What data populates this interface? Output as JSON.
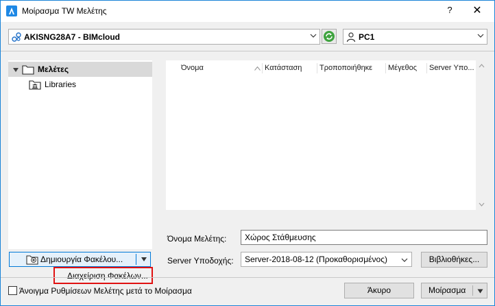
{
  "window": {
    "title": "Μοίρασμα TW Μελέτης"
  },
  "titlebar": {
    "help_label": "?",
    "close_label": "✕"
  },
  "server_combo": {
    "value": "AKISNG28A7 - BIMcloud"
  },
  "user_combo": {
    "value": "PC1"
  },
  "tree": {
    "items": [
      {
        "label": "Μελέτες",
        "selected": true
      },
      {
        "label": "Libraries",
        "selected": false
      }
    ]
  },
  "list": {
    "columns": [
      "Όνομα",
      "Κατάσταση",
      "Τροποποιήθηκε",
      "Μέγεθος",
      "Server Υπο..."
    ],
    "rows": []
  },
  "form": {
    "project_name_label": "Όνομα Μελέτης:",
    "project_name_value": "Χώρος Στάθμευσης",
    "host_server_label": "Server Υποδοχής:",
    "host_server_value": "Server-2018-08-12 (Προκαθορισμένος)",
    "libraries_button": "Βιβλιοθήκες..."
  },
  "create_folder_button": {
    "label": "Δημιουργία Φακέλου..."
  },
  "popup_menu": {
    "items": [
      "Διαχείριση Φακέλων..."
    ]
  },
  "footer": {
    "open_settings_checkbox_label": "Άνοιγμα Ρυθμίσεων Μελέτης μετά το Μοίρασμα",
    "open_settings_checked": false,
    "cancel_button": "Άκυρο",
    "share_button": "Μοίρασμα"
  },
  "colors": {
    "accent": "#0078d7",
    "highlight_border": "#e01010",
    "selection": "#d9d9d9",
    "refresh_green": "#3fa33f"
  }
}
